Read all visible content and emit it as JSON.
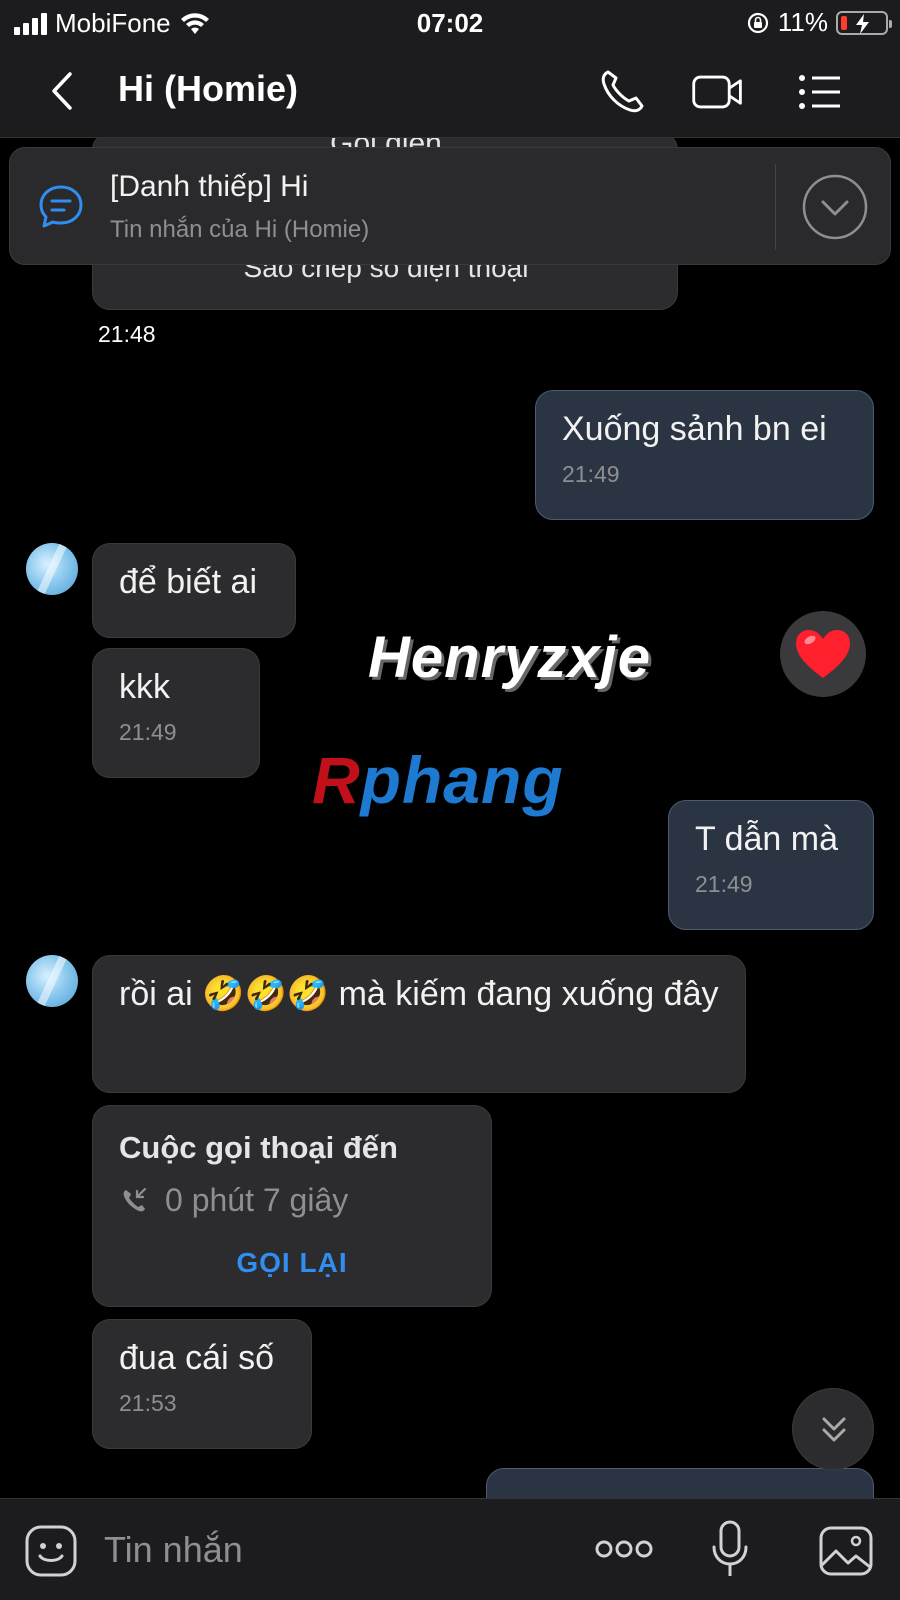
{
  "status_bar": {
    "carrier": "MobiFone",
    "time": "07:02",
    "battery_percent": "11%",
    "battery_level": 0.11,
    "icons": [
      "signal-bars-icon",
      "wifi-icon",
      "rotation-lock-icon",
      "battery-charging-icon"
    ]
  },
  "header": {
    "title": "Hi (Homie)",
    "icons": [
      "back-chevron-icon",
      "phone-call-icon",
      "video-call-icon",
      "menu-list-icon"
    ]
  },
  "pinned": {
    "title": "[Danh thiếp] Hi",
    "subtitle": "Tin nhắn của Hi (Homie)",
    "hidden_text": "Gọi điện",
    "icons": [
      "message-icon",
      "expand-down-icon"
    ]
  },
  "messages": [
    {
      "id": "card_action",
      "side": "them",
      "text": "Sao chép số điện thoại"
    },
    {
      "id": "card_time",
      "side": "them",
      "time": "21:48"
    },
    {
      "id": "m1",
      "side": "me",
      "text": "Xuống sảnh bn ei",
      "time": "21:49"
    },
    {
      "id": "m2",
      "side": "them",
      "text": "để biết ai"
    },
    {
      "id": "m3",
      "side": "them",
      "text": "kkk",
      "time": "21:49",
      "reaction": "heart"
    },
    {
      "id": "m4",
      "side": "me",
      "text": "T dẫn mà",
      "time": "21:49"
    },
    {
      "id": "m5",
      "side": "them",
      "text": "rồi ai 🤣🤣🤣 mà kiếm đang xuống đây"
    },
    {
      "id": "m6",
      "side": "them",
      "type": "call",
      "title": "Cuộc gọi thoại đến",
      "duration": "0 phút 7 giây",
      "action": "GỌI LẠI"
    },
    {
      "id": "m7",
      "side": "them",
      "text": "đua cái số",
      "time": "21:53"
    }
  ],
  "watermark": {
    "line1": "Henryzxje",
    "line2_red": "R",
    "line2_blue": "phang"
  },
  "input_bar": {
    "placeholder": "Tin nhắn",
    "icons": [
      "sticker-icon",
      "more-icon",
      "microphone-icon",
      "image-icon"
    ]
  },
  "colors": {
    "background": "#000000",
    "bar": "#1c1c1e",
    "bubble_them": "#2c2c2e",
    "bubble_me": "#2b3442",
    "accent_blue": "#2f8ef0",
    "battery_red": "#ff3b30"
  }
}
